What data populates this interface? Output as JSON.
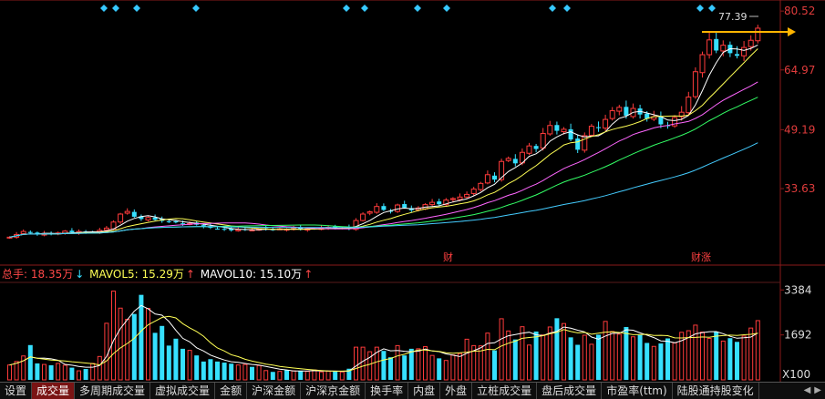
{
  "price_axis": {
    "ticks": [
      "80.52",
      "64.97",
      "49.19",
      "33.63"
    ]
  },
  "volume_axis": {
    "ticks": [
      "3384",
      "1692"
    ],
    "unit": "X100"
  },
  "max_price_label": "77.39",
  "event_markers": [
    "财",
    "财涨"
  ],
  "volume_legend": {
    "total": "总手: 18.35万",
    "total_arrow": "↓",
    "mavol5": "MAVOL5: 15.29万",
    "mavol5_arrow": "↑",
    "mavol10": "MAVOL10: 15.10万",
    "mavol10_arrow": "↑"
  },
  "tabs": [
    "设置",
    "成交量",
    "多周期成交量",
    "虚拟成交量",
    "金额",
    "沪深金额",
    "沪深京金额",
    "换手率",
    "内盘",
    "外盘",
    "立桩成交量",
    "盘后成交量",
    "市盈率(ttm)",
    "陆股通持股变化"
  ],
  "active_tab": "成交量",
  "colors": {
    "up": "#ff3b3b",
    "down": "#36e0ff",
    "ma5": "#ffffff",
    "ma10": "#ffff55",
    "ma20": "#ff66ff",
    "ma30": "#33ff66",
    "ma60": "#44ccff",
    "arrow": "#ffb400"
  },
  "chart_data": {
    "type": "candlestick",
    "price_ticks": [
      80.52,
      64.97,
      49.19,
      33.63
    ],
    "volume_ticks": [
      3384,
      1692
    ],
    "closes": [
      20.8,
      21.5,
      22.3,
      21.9,
      21.6,
      21.8,
      21.5,
      21.9,
      22.4,
      22.1,
      22.3,
      22.0,
      22.2,
      22.6,
      23.2,
      24.8,
      26.9,
      27.6,
      26.2,
      25.6,
      26.0,
      25.4,
      25.1,
      24.9,
      24.7,
      24.3,
      24.4,
      24.1,
      23.6,
      23.3,
      23.0,
      22.9,
      22.6,
      22.8,
      22.9,
      22.7,
      22.9,
      23.0,
      22.8,
      23.0,
      22.9,
      23.1,
      22.8,
      23.0,
      23.1,
      23.2,
      23.4,
      23.2,
      23.3,
      23.1,
      25.2,
      26.9,
      27.5,
      28.9,
      28.0,
      27.6,
      29.3,
      28.6,
      27.9,
      28.5,
      29.4,
      30.0,
      29.5,
      30.6,
      31.0,
      31.4,
      32.1,
      33.5,
      35.0,
      37.3,
      36.0,
      40.8,
      41.6,
      40.3,
      43.2,
      44.9,
      44.1,
      48.2,
      50.3,
      48.9,
      49.3,
      46.6,
      43.9,
      47.6,
      50.1,
      49.6,
      51.9,
      54.2,
      55.1,
      52.9,
      54.8,
      53.2,
      52.1,
      52.6,
      50.6,
      50.2,
      52.4,
      53.8,
      57.8,
      64.5,
      69.0,
      72.9,
      70.1,
      71.5,
      69.4,
      68.7,
      70.9,
      72.8,
      76.0
    ],
    "volumes": [
      560,
      690,
      900,
      1310,
      620,
      580,
      550,
      620,
      550,
      460,
      340,
      410,
      620,
      880,
      2130,
      3340,
      2700,
      2280,
      2480,
      3200,
      2690,
      1770,
      2030,
      1290,
      1550,
      1170,
      1110,
      920,
      690,
      780,
      690,
      650,
      610,
      560,
      580,
      490,
      540,
      350,
      300,
      320,
      360,
      340,
      340,
      320,
      370,
      300,
      330,
      320,
      300,
      420,
      1230,
      1230,
      1060,
      1230,
      1090,
      850,
      1290,
      920,
      1170,
      1170,
      1250,
      920,
      810,
      730,
      940,
      990,
      1530,
      1290,
      1280,
      1760,
      1110,
      2300,
      1840,
      1520,
      2000,
      1310,
      1820,
      1690,
      1990,
      2320,
      2120,
      1600,
      1320,
      1680,
      1340,
      1700,
      2200,
      1820,
      1720,
      1990,
      1620,
      1690,
      1390,
      1260,
      1370,
      1560,
      1390,
      1790,
      1850,
      2060,
      1800,
      1560,
      1810,
      1460,
      1570,
      1430,
      1650,
      1950,
      2230
    ]
  }
}
